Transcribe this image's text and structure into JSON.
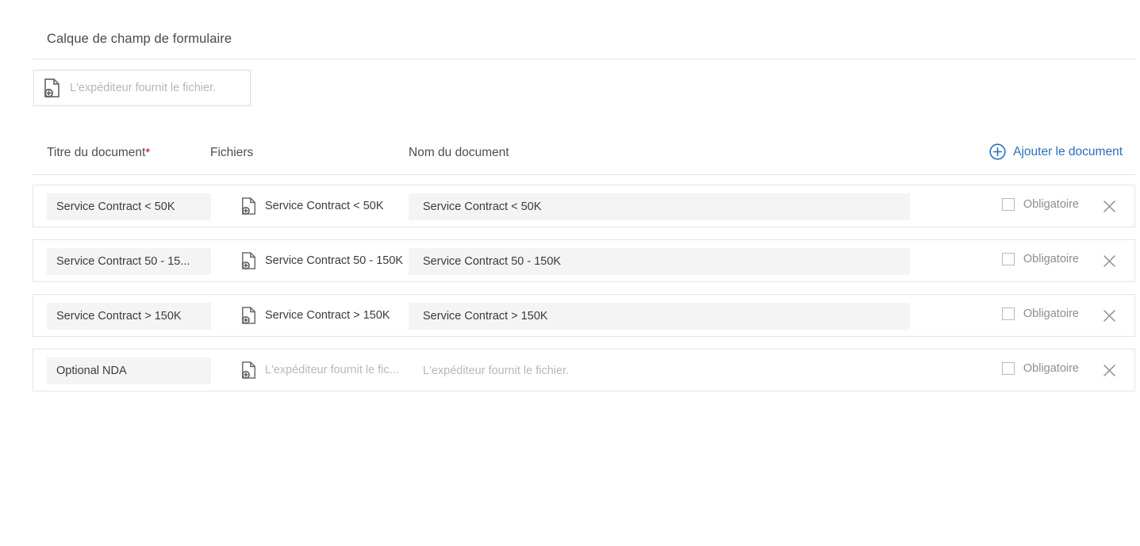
{
  "section": {
    "title": "Calque de champ de formulaire"
  },
  "template_field": {
    "placeholder": "L'expéditeur fournit le fichier.",
    "icon": "document-add-icon"
  },
  "columns": {
    "title": "Titre du document",
    "required_marker": "*",
    "files": "Fichiers",
    "document_name": "Nom du document"
  },
  "actions": {
    "add_document": "Ajouter le document",
    "add_icon": "plus-circle-icon",
    "accent_color": "#2a6ebb",
    "required_star_color": "#d0021b"
  },
  "labels": {
    "required_checkbox": "Obligatoire",
    "clear_icon": "clear-circle-icon",
    "remove_icon": "close-icon",
    "file_icon": "document-add-icon"
  },
  "rows": [
    {
      "title": "Service Contract < 50K",
      "file_name": "Service Contract < 50K",
      "file_empty": false,
      "document_name": "Service Contract < 50K",
      "document_name_empty": false,
      "required_label": "Obligatoire",
      "required_checked": false,
      "has_clear": true
    },
    {
      "title": "Service Contract 50 - 15...",
      "file_name": "Service Contract 50 - 150K",
      "file_empty": false,
      "document_name": "Service Contract 50 - 150K",
      "document_name_empty": false,
      "required_label": "Obligatoire",
      "required_checked": false,
      "has_clear": true
    },
    {
      "title": "Service Contract > 150K",
      "file_name": "Service Contract > 150K",
      "file_empty": false,
      "document_name": "Service Contract > 150K",
      "document_name_empty": false,
      "required_label": "Obligatoire",
      "required_checked": false,
      "has_clear": true
    },
    {
      "title": "Optional NDA",
      "file_name": "L'expéditeur fournit le fic...",
      "file_empty": true,
      "document_name": "L'expéditeur fournit le fichier.",
      "document_name_empty": true,
      "required_label": "Obligatoire",
      "required_checked": false,
      "has_clear": false
    }
  ]
}
